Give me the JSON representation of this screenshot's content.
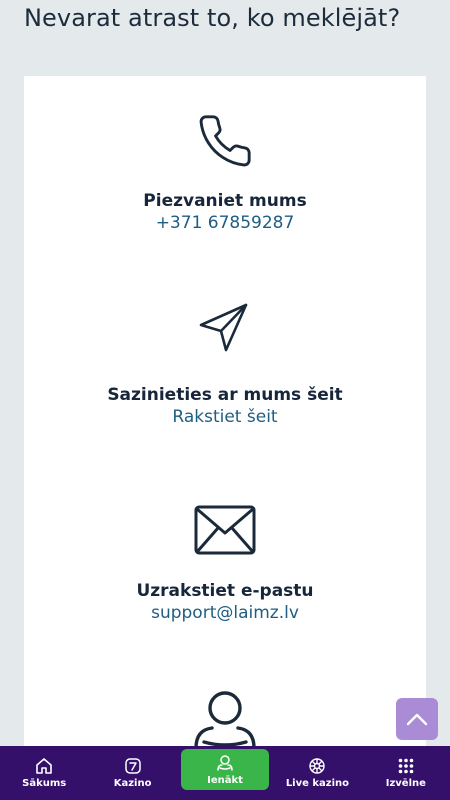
{
  "page": {
    "heading": "Nevarat atrast to, ko meklējāt?"
  },
  "contacts": [
    {
      "icon": "phone-icon",
      "title": "Piezvaniet mums",
      "value": "+371 67859287"
    },
    {
      "icon": "send-icon",
      "title": "Sazinieties ar mums šeit",
      "value": "Rakstiet šeit"
    },
    {
      "icon": "mail-icon",
      "title": "Uzrakstiet e-pastu",
      "value": "support@laimz.lv"
    },
    {
      "icon": "agent-icon"
    }
  ],
  "nav": {
    "items": [
      {
        "label": "Sākums",
        "icon": "home-icon"
      },
      {
        "label": "Kazino",
        "icon": "slot-icon"
      },
      {
        "label": "Ienākt",
        "icon": "login-icon"
      },
      {
        "label": "Live kazino",
        "icon": "roulette-icon"
      },
      {
        "label": "Izvēlne",
        "icon": "menu-grid-icon"
      }
    ]
  },
  "colors": {
    "background": "#e4eaec",
    "nav_background": "#34106b",
    "login_button": "#3ab54a",
    "link": "#1f5d82",
    "scroll_top": "#a98bd6"
  }
}
